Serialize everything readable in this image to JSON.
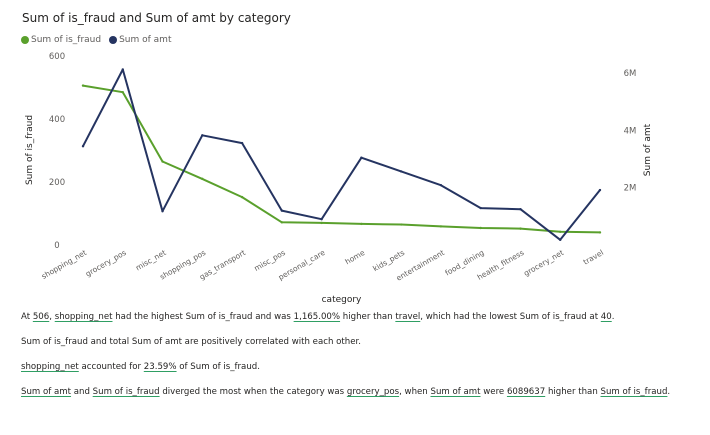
{
  "chart_data": {
    "type": "line",
    "title": "Sum of is_fraud and Sum of amt by category",
    "xlabel": "category",
    "ylabel_left": "Sum of is_fraud",
    "ylabel_right": "Sum of amt",
    "categories": [
      "shopping_net",
      "grocery_pos",
      "misc_net",
      "shopping_pos",
      "gas_transport",
      "misc_pos",
      "personal_care",
      "home",
      "kids_pets",
      "entertainment",
      "food_dining",
      "health_fitness",
      "grocery_net",
      "travel"
    ],
    "left_axis": {
      "ticks": [
        "0",
        "200",
        "400",
        "600"
      ],
      "tick_values": [
        0,
        200,
        400,
        600
      ],
      "ylim": [
        0,
        600
      ]
    },
    "right_axis": {
      "ticks": [
        "2M",
        "4M",
        "6M"
      ],
      "tick_values": [
        2000000,
        4000000,
        6000000
      ],
      "ylim": [
        0,
        6600000
      ]
    },
    "series": [
      {
        "name": "Sum of is_fraud",
        "axis": "left",
        "color": "#5aa02c",
        "values": [
          506,
          485,
          265,
          210,
          152,
          72,
          70,
          67,
          65,
          59,
          54,
          52,
          42,
          40
        ]
      },
      {
        "name": "Sum of amt",
        "axis": "right",
        "color": "#253461",
        "values": [
          3450000,
          6130000,
          1180000,
          3830000,
          3560000,
          1200000,
          900000,
          3050000,
          2570000,
          2090000,
          1290000,
          1250000,
          180000,
          1920000
        ]
      }
    ],
    "legend_position": "top-left",
    "grid": false
  },
  "insights": {
    "line1": {
      "p1": "At ",
      "v1": "506",
      "p2": ", ",
      "v2": "shopping_net",
      "p3": " had the highest Sum of is_fraud and was ",
      "v3": "1,165.00%",
      "p4": " higher than ",
      "v4": "travel",
      "p5": ", which had the lowest Sum of is_fraud at ",
      "v5": "40",
      "p6": "."
    },
    "line2": "Sum of is_fraud and total Sum of amt are positively correlated with each other.",
    "line3": {
      "v1": "shopping_net",
      "p1": " accounted for ",
      "v2": "23.59%",
      "p2": " of Sum of is_fraud."
    },
    "line4": {
      "v1": "Sum of amt",
      "p1": " and ",
      "v2": "Sum of is_fraud",
      "p2": " diverged the most when the category was ",
      "v3": "grocery_pos",
      "p3": ", when ",
      "v4": "Sum of amt",
      "p4": " were ",
      "v5": "6089637",
      "p5": " higher than ",
      "v6": "Sum of is_fraud",
      "p6": "."
    }
  }
}
